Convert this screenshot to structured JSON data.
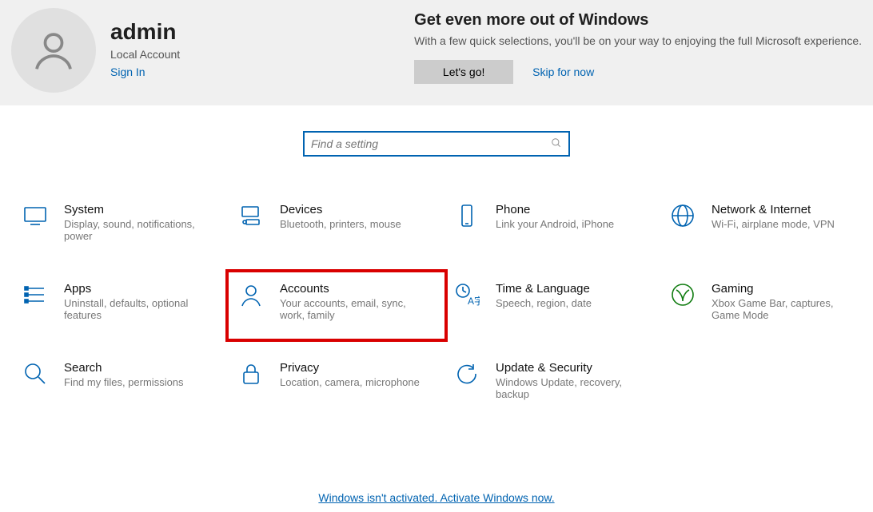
{
  "user": {
    "name": "admin",
    "account_type": "Local Account",
    "sign_in": "Sign In"
  },
  "promo": {
    "title": "Get even more out of Windows",
    "subtitle": "With a few quick selections, you'll be on your way to enjoying the full Microsoft experience.",
    "lets_go": "Let's go!",
    "skip": "Skip for now"
  },
  "search": {
    "placeholder": "Find a setting"
  },
  "tiles": {
    "system": {
      "title": "System",
      "desc": "Display, sound, notifications, power"
    },
    "devices": {
      "title": "Devices",
      "desc": "Bluetooth, printers, mouse"
    },
    "phone": {
      "title": "Phone",
      "desc": "Link your Android, iPhone"
    },
    "network": {
      "title": "Network & Internet",
      "desc": "Wi-Fi, airplane mode, VPN"
    },
    "apps": {
      "title": "Apps",
      "desc": "Uninstall, defaults, optional features"
    },
    "accounts": {
      "title": "Accounts",
      "desc": "Your accounts, email, sync, work, family"
    },
    "time": {
      "title": "Time & Language",
      "desc": "Speech, region, date"
    },
    "gaming": {
      "title": "Gaming",
      "desc": "Xbox Game Bar, captures, Game Mode"
    },
    "search": {
      "title": "Search",
      "desc": "Find my files, permissions"
    },
    "privacy": {
      "title": "Privacy",
      "desc": "Location, camera, microphone"
    },
    "update": {
      "title": "Update & Security",
      "desc": "Windows Update, recovery, backup"
    }
  },
  "activation": "Windows isn't activated. Activate Windows now."
}
